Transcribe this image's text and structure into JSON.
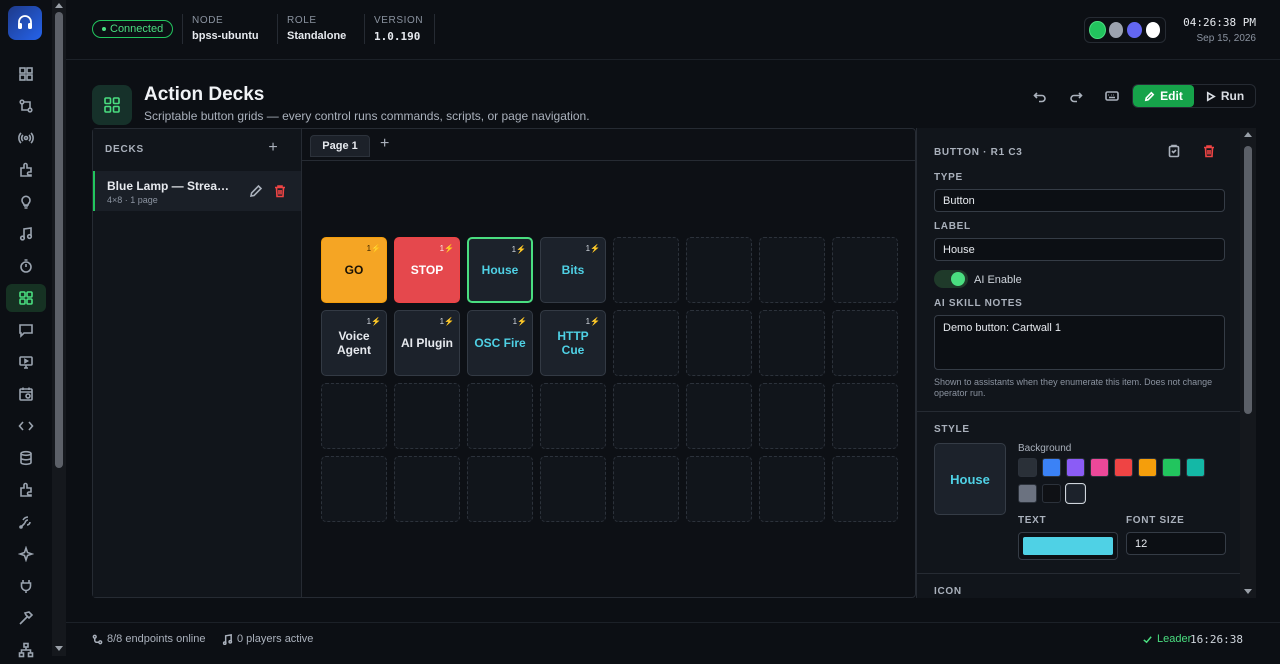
{
  "topbar": {
    "status": "Connected",
    "node_label": "NODE",
    "node_value": "bpss-ubuntu",
    "role_label": "ROLE",
    "role_value": "Standalone",
    "version_label": "VERSION",
    "version_value": "1.0.190",
    "theme_colors": [
      "#22c55e",
      "#9ca3af",
      "#6366f1",
      "#ffffff"
    ],
    "time": "04:26:38 PM",
    "date": "Sep 15, 2026"
  },
  "rail": {
    "icons": [
      "dashboard-icon",
      "routing-icon",
      "broadcast-icon",
      "plugin-icon",
      "lightbulb-icon",
      "music-icon",
      "timer-icon",
      "action-decks-icon",
      "chat-icon",
      "display-icon",
      "schedule-icon",
      "code-icon",
      "database-icon",
      "extension-icon",
      "signal-icon",
      "sparkle-icon",
      "power-plug-icon",
      "hammer-icon",
      "network-icon"
    ],
    "active_index": 7
  },
  "header": {
    "title": "Action Decks",
    "subtitle": "Scriptable button grids — every control runs commands, scripts, or page navigation.",
    "edit_label": "Edit",
    "run_label": "Run"
  },
  "decks": {
    "heading": "DECKS",
    "items": [
      {
        "name": "Blue Lamp — Stream Deck",
        "meta": "4×8 · 1 page"
      }
    ]
  },
  "tabs": [
    {
      "label": "Page 1"
    }
  ],
  "grid": {
    "rows": 4,
    "cols": 8,
    "buttons": [
      {
        "row": 0,
        "col": 0,
        "label": "GO",
        "badge": "1⚡",
        "style": "go",
        "text_color": "#1a1205"
      },
      {
        "row": 0,
        "col": 1,
        "label": "STOP",
        "badge": "1⚡",
        "style": "stop",
        "text_color": "#ffffff"
      },
      {
        "row": 0,
        "col": 2,
        "label": "House",
        "badge": "1⚡",
        "style": "selected",
        "text_color": "#4fd1e5"
      },
      {
        "row": 0,
        "col": 3,
        "label": "Bits",
        "badge": "1⚡",
        "style": "",
        "text_color": "#4fd1e5"
      },
      {
        "row": 1,
        "col": 0,
        "label": "Voice Agent",
        "badge": "1⚡",
        "style": "",
        "text_color": "#e6e9ee"
      },
      {
        "row": 1,
        "col": 1,
        "label": "AI Plugin",
        "badge": "1⚡",
        "style": "",
        "text_color": "#e6e9ee"
      },
      {
        "row": 1,
        "col": 2,
        "label": "OSC Fire",
        "badge": "1⚡",
        "style": "",
        "text_color": "#4fd1e5"
      },
      {
        "row": 1,
        "col": 3,
        "label": "HTTP Cue",
        "badge": "1⚡",
        "style": "",
        "text_color": "#4fd1e5"
      }
    ]
  },
  "inspector": {
    "heading": "BUTTON · R1 C3",
    "type_label": "TYPE",
    "type_value": "Button",
    "label_label": "LABEL",
    "label_value": "House",
    "ai_enable_label": "AI Enable",
    "notes_label": "AI SKILL NOTES",
    "notes_value": "Demo button: Cartwall 1",
    "notes_help": "Shown to assistants when they enumerate this item. Does not change operator run.",
    "style_label": "STYLE",
    "preview_label": "House",
    "background_label": "Background",
    "swatches": [
      "#2a3038",
      "#3b82f6",
      "#8b5cf6",
      "#ec4899",
      "#ef4444",
      "#f59e0b",
      "#22c55e",
      "#14b8a6",
      "#6b7280",
      "#0f1115",
      "#1c222b"
    ],
    "selected_swatch": 10,
    "text_label": "TEXT",
    "text_color": "#4fd1e5",
    "font_size_label": "FONT SIZE",
    "font_size_value": "12",
    "icon_label": "ICON"
  },
  "footer": {
    "endpoints": "8/8 endpoints online",
    "players": "0 players active",
    "leader": "Leader",
    "time": "16:26:38"
  }
}
